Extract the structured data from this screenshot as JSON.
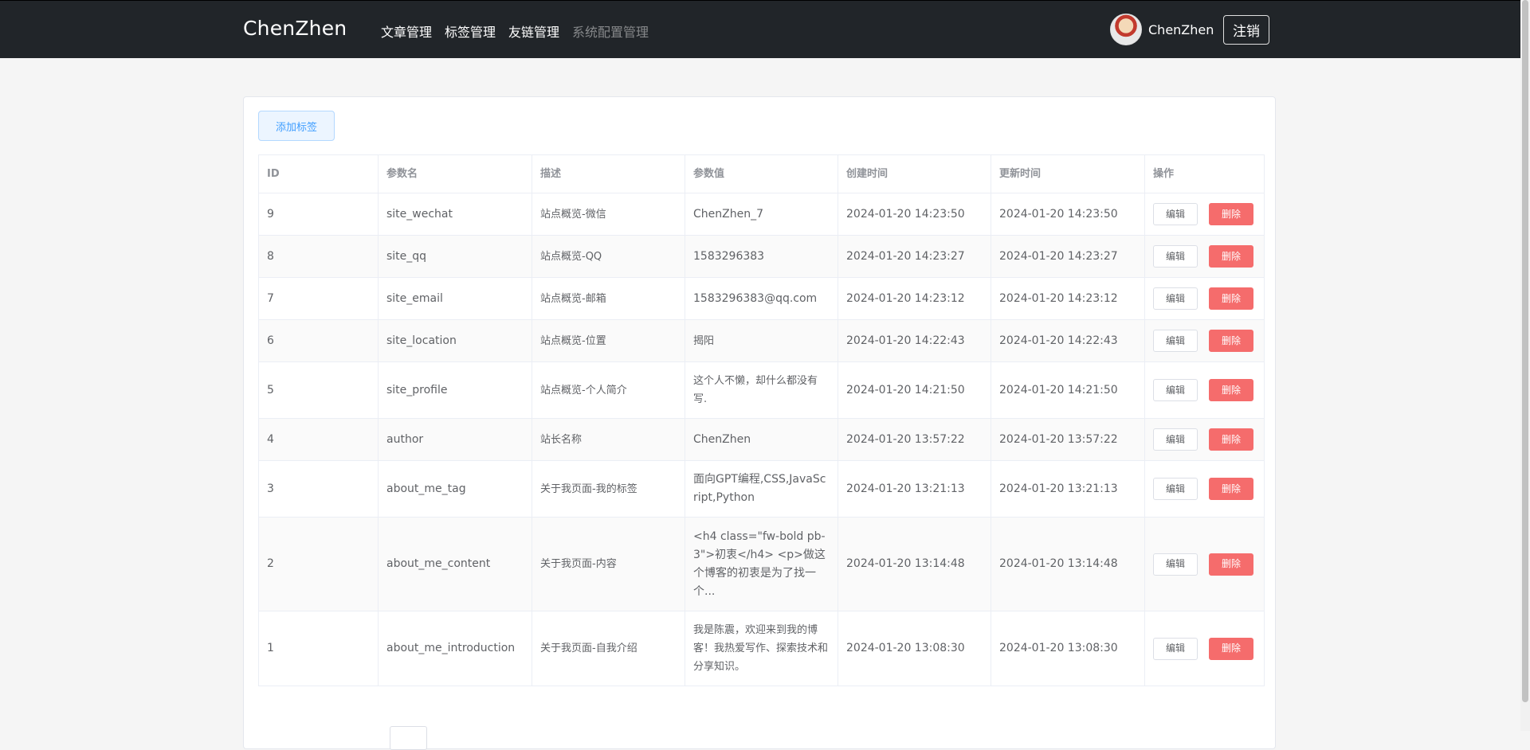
{
  "navbar": {
    "brand": "ChenZhen",
    "links": [
      "文章管理",
      "标签管理",
      "友链管理",
      "系统配置管理"
    ],
    "user_name": "ChenZhen",
    "logout_label": "注销"
  },
  "toolbar": {
    "add_label": "添加标签"
  },
  "table": {
    "headers": [
      "ID",
      "参数名",
      "描述",
      "参数值",
      "创建时间",
      "更新时间",
      "操作"
    ],
    "edit_label": "编辑",
    "delete_label": "删除",
    "rows": [
      {
        "id": "9",
        "name": "site_wechat",
        "desc": "站点概览-微信",
        "value": "ChenZhen_7",
        "created": "2024-01-20 14:23:50",
        "updated": "2024-01-20 14:23:50"
      },
      {
        "id": "8",
        "name": "site_qq",
        "desc": "站点概览-QQ",
        "value": "1583296383",
        "created": "2024-01-20 14:23:27",
        "updated": "2024-01-20 14:23:27"
      },
      {
        "id": "7",
        "name": "site_email",
        "desc": "站点概览-邮箱",
        "value": "1583296383@qq.com",
        "created": "2024-01-20 14:23:12",
        "updated": "2024-01-20 14:23:12"
      },
      {
        "id": "6",
        "name": "site_location",
        "desc": "站点概览-位置",
        "value": "揭阳",
        "created": "2024-01-20 14:22:43",
        "updated": "2024-01-20 14:22:43"
      },
      {
        "id": "5",
        "name": "site_profile",
        "desc": "站点概览-个人简介",
        "value": "这个人不懒，却什么都没有写.",
        "created": "2024-01-20 14:21:50",
        "updated": "2024-01-20 14:21:50"
      },
      {
        "id": "4",
        "name": "author",
        "desc": "站长名称",
        "value": "ChenZhen",
        "created": "2024-01-20 13:57:22",
        "updated": "2024-01-20 13:57:22"
      },
      {
        "id": "3",
        "name": "about_me_tag",
        "desc": "关于我页面-我的标签",
        "value": "面向GPT编程,CSS,JavaScript,Python",
        "created": "2024-01-20 13:21:13",
        "updated": "2024-01-20 13:21:13"
      },
      {
        "id": "2",
        "name": "about_me_content",
        "desc": "关于我页面-内容",
        "value": "<h4 class=\"fw-bold pb-3\">初衷</h4> <p>做这个博客的初衷是为了找一个...",
        "created": "2024-01-20 13:14:48",
        "updated": "2024-01-20 13:14:48"
      },
      {
        "id": "1",
        "name": "about_me_introduction",
        "desc": "关于我页面-自我介绍",
        "value": "我是陈震，欢迎来到我的博客！我热爱写作、探索技术和分享知识。",
        "created": "2024-01-20 13:08:30",
        "updated": "2024-01-20 13:08:30"
      }
    ]
  }
}
